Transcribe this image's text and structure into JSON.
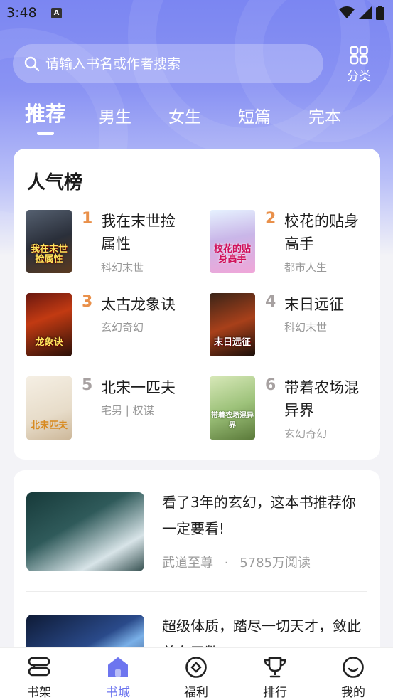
{
  "status_bar": {
    "time": "3:48",
    "notification_badge": "A"
  },
  "search": {
    "placeholder": "请输入书名或作者搜索"
  },
  "category_button": {
    "label": "分类"
  },
  "tabs": [
    {
      "label": "推荐",
      "active": true
    },
    {
      "label": "男生",
      "active": false
    },
    {
      "label": "女生",
      "active": false
    },
    {
      "label": "短篇",
      "active": false
    },
    {
      "label": "完本",
      "active": false
    }
  ],
  "ranking": {
    "title": "人气榜",
    "books": [
      {
        "rank": "1",
        "name": "我在末世捡属性",
        "genre": "科幻末世",
        "cover_text": "我在末世捡属性"
      },
      {
        "rank": "2",
        "name": "校花的贴身高手",
        "genre": "都市人生",
        "cover_text": "校花的贴身高手"
      },
      {
        "rank": "3",
        "name": "太古龙象诀",
        "genre": "玄幻奇幻",
        "cover_text": "龙象诀"
      },
      {
        "rank": "4",
        "name": "末日远征",
        "genre": "科幻末世",
        "cover_text": "末日远征"
      },
      {
        "rank": "5",
        "name": "北宋一匹夫",
        "genre": "宅男 | 权谋",
        "cover_text": "北宋匹夫"
      },
      {
        "rank": "6",
        "name": "带着农场混异界",
        "genre": "玄幻奇幻",
        "cover_text": "带着农场混异界"
      }
    ]
  },
  "feed": [
    {
      "text": "看了3年的玄幻，这本书推荐你一定要看!",
      "book": "武道至尊",
      "separator": "·",
      "reads": "5785万阅读"
    },
    {
      "text": "超级体质，踏尽一切天才，敛此着有天数!"
    }
  ],
  "bottom_nav": [
    {
      "label": "书架",
      "icon": "bookshelf-icon",
      "active": false
    },
    {
      "label": "书城",
      "icon": "home-icon",
      "active": true
    },
    {
      "label": "福利",
      "icon": "welfare-icon",
      "active": false
    },
    {
      "label": "排行",
      "icon": "trophy-icon",
      "active": false
    },
    {
      "label": "我的",
      "icon": "smile-icon",
      "active": false
    }
  ],
  "colors": {
    "accent": "#6d75ef",
    "rank_top": "#e9904a",
    "rank_other": "#a7a1a1",
    "hero": "#7b86f2"
  }
}
